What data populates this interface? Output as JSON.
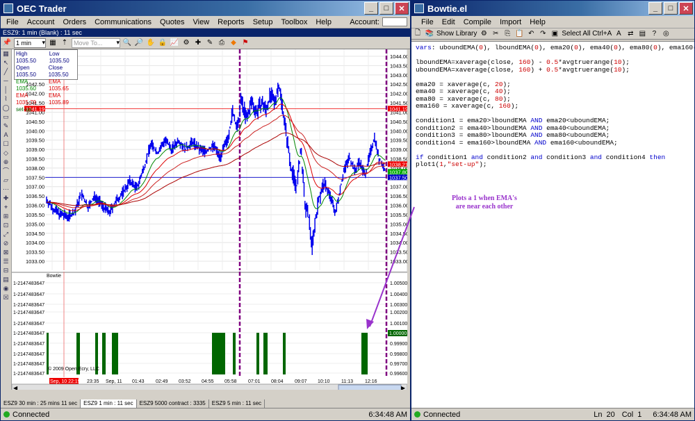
{
  "oec": {
    "title": "OEC Trader",
    "menu": [
      "File",
      "Account",
      "Orders",
      "Communications",
      "Quotes",
      "View",
      "Reports",
      "Setup",
      "Toolbox",
      "Help"
    ],
    "account_label": "Account:",
    "chart_header": "ESZ9: 1 min (Blank) : 11 sec",
    "interval_select": "1 min",
    "move_to": "Move To...",
    "legend": {
      "high": "High 1035.50",
      "low": "Low 1035.50",
      "open": "Open 1035.50",
      "close": "Close 1035.50",
      "ema_g": "EMA 1035.60",
      "ema_r1": "EMA 1035.65",
      "ema_r2": "EMA 1035.79",
      "ema_r3": "EMA 1035.89",
      "setup": "set-up"
    },
    "price_ticks": [
      "1044.00",
      "1043.50",
      "1043.00",
      "1042.50",
      "1042.00",
      "1041.50",
      "1041.00",
      "1040.50",
      "1040.00",
      "1039.50",
      "1039.00",
      "1038.50",
      "1038.00",
      "1037.50",
      "1037.00",
      "1036.50",
      "1036.00",
      "1035.50",
      "1035.00",
      "1034.50",
      "1034.00",
      "1033.50",
      "1033.00"
    ],
    "left_ticks": [
      "1042.50",
      "1042.00",
      "1041.50",
      "1041.00",
      "1040.50",
      "1040.00",
      "1039.50",
      "1039.00",
      "1038.50",
      "1038.00",
      "1037.50",
      "1037.00",
      "1036.50",
      "1036.00",
      "1035.50",
      "1035.00",
      "1034.50",
      "1034.00",
      "1033.50",
      "1033.00"
    ],
    "price_marker_1": "1041.19",
    "price_marker_2": "1038.21",
    "price_marker_3": "1037.80",
    "price_marker_4": "1037.50",
    "indicator_name": "Bowtie",
    "indicator_left": [
      "1-2147483647",
      "1-2147483647",
      "1-2147483647",
      "1-2147483647",
      "1-2147483647",
      "1-2147483647",
      "1-2147483647",
      "1-2147483647",
      "1-2147483647",
      "1-2147483647"
    ],
    "indicator_right": [
      "1.00500",
      "1.00400",
      "1.00300",
      "1.00200",
      "1.00100",
      "1.00000",
      "0.99900",
      "0.99800",
      "0.99700",
      "0.99600"
    ],
    "indicator_marker": "1.00000",
    "copyright": "© 2009 Open Ecry, LLC",
    "time_labels": [
      "Sep, 10 22:19",
      "23:35",
      "Sep, 11",
      "01:43",
      "02:49",
      "03:52",
      "04:55",
      "05:58",
      "07:01",
      "08:04",
      "09:07",
      "10:10",
      "11:13",
      "12:16"
    ],
    "bottom_tabs": [
      "ESZ9 30 min : 25 mins 11 sec",
      "ESZ9 1 min : 11 sec",
      "ESZ9 5000 contract : 3335",
      "ESZ9 5 min : 11 sec"
    ],
    "status_connected": "Connected",
    "status_time": "6:34:48 AM",
    "colors": {
      "candle": "#0000ee",
      "ema_green": "#008800",
      "ema_red": "#dd0000",
      "bar": "#006600",
      "marker_red": "#ee0000",
      "marker_green": "#00aa00",
      "marker_blue": "#0000cc"
    }
  },
  "bowtie": {
    "title": "Bowtie.el",
    "menu": [
      "File",
      "Edit",
      "Compile",
      "Import",
      "Help"
    ],
    "show_library": "Show Library",
    "select_all": "Select All Ctrl+A",
    "code": [
      "vars: uboundEMA(0), lboundEMA(0), ema20(0), ema40(0), ema80(0), ema160(0);",
      "",
      "lboundEMA=xaverage(close, 160) - 0.5*avgtruerange(10);",
      "uboundEMA=xaverage(close, 160) + 0.5*avgtruerange(10);",
      "",
      "ema20 = xaverage(c, 20);",
      "ema40 = xaverage(c, 40);",
      "ema80 = xaverage(c, 80);",
      "ema160 = xaverage(c, 160);",
      "",
      "condition1 = ema20>lboundEMA AND ema20<uboundEMA;",
      "condition2 = ema40>lboundEMA AND ema40<uboundEMA;",
      "condition3 = ema80>lboundEMA AND ema80<uboundEMA;",
      "condition4 = ema160>lboundEMA AND ema160<uboundEMA;",
      "",
      "if condition1 and condition2 and condition3 and condition4 then",
      "plot1(1,\"set-up\");"
    ],
    "annotation": "Plots a 1 when EMA's are near each other",
    "annotation_color": "#9933cc",
    "status_connected": "Connected",
    "status_ln_label": "Ln",
    "status_ln": "20",
    "status_col_label": "Col",
    "status_col": "1",
    "status_time": "6:34:48 AM"
  }
}
